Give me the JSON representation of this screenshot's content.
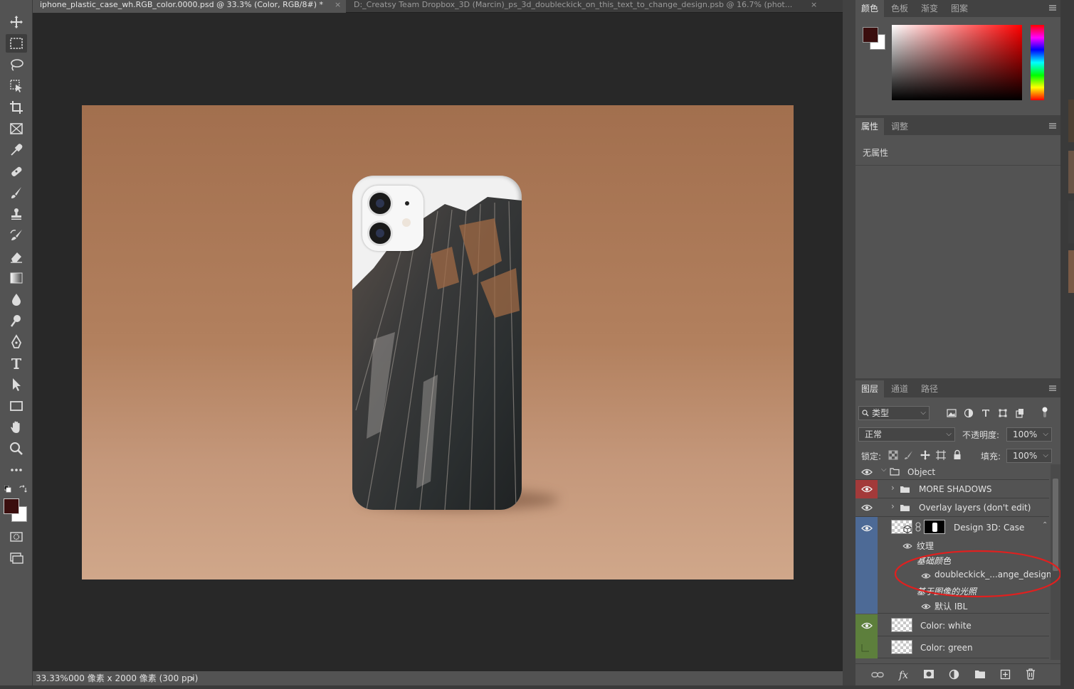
{
  "tabs": [
    {
      "title": "iphone_plastic_case_wh.RGB_color.0000.psd @ 33.3% (Color, RGB/8#) *",
      "close": "×"
    },
    {
      "title": "D:_Creatsy Team Dropbox_3D (Marcin)_ps_3d_doubleckick_on_this_text_to_change_design.psb @ 16.7% (phot...",
      "close": "×"
    }
  ],
  "status": {
    "zoom": "33.33%",
    "doc_size": "000 像素 x 2000 像素 (300 ppi)",
    "arrow": "›"
  },
  "color_panel": {
    "tabs": [
      "颜色",
      "色板",
      "渐变",
      "图案"
    ],
    "foreground": "#3a0e0e",
    "background": "#ffffff"
  },
  "props_panel": {
    "tabs": [
      "属性",
      "调整"
    ],
    "empty_text": "无属性"
  },
  "layers_panel": {
    "tabs": [
      "图层",
      "通道",
      "路径"
    ],
    "filter_kind": "类型",
    "blend_mode": "正常",
    "opacity_label": "不透明度:",
    "opacity": "100%",
    "lock_label": "锁定:",
    "fill_label": "填充:",
    "fill": "100%",
    "layers": [
      {
        "name": "Object",
        "kind": "group",
        "color": "none",
        "expanded": true
      },
      {
        "name": "MORE SHADOWS",
        "kind": "group",
        "color": "red"
      },
      {
        "name": "Overlay layers (don't edit)",
        "kind": "group",
        "color": "none"
      },
      {
        "name": "Design 3D: Case",
        "kind": "3d",
        "color": "blue"
      },
      {
        "name": "纹理",
        "kind": "sub"
      },
      {
        "name": "基础颜色",
        "kind": "subhead"
      },
      {
        "name": "doubleckick_...ange_design",
        "kind": "sub2"
      },
      {
        "name": "基于图像的光照",
        "kind": "subhead"
      },
      {
        "name": "默认 IBL",
        "kind": "sub2"
      },
      {
        "name": "Color: white",
        "kind": "pixel",
        "color": "green"
      },
      {
        "name": "Color: green",
        "kind": "pixel",
        "color": "green"
      }
    ],
    "highlight_color": "#e0201f"
  },
  "colors": {
    "label_red": "#a33a3a",
    "label_blue": "#4d6a96",
    "label_green": "#5d7f3c"
  }
}
